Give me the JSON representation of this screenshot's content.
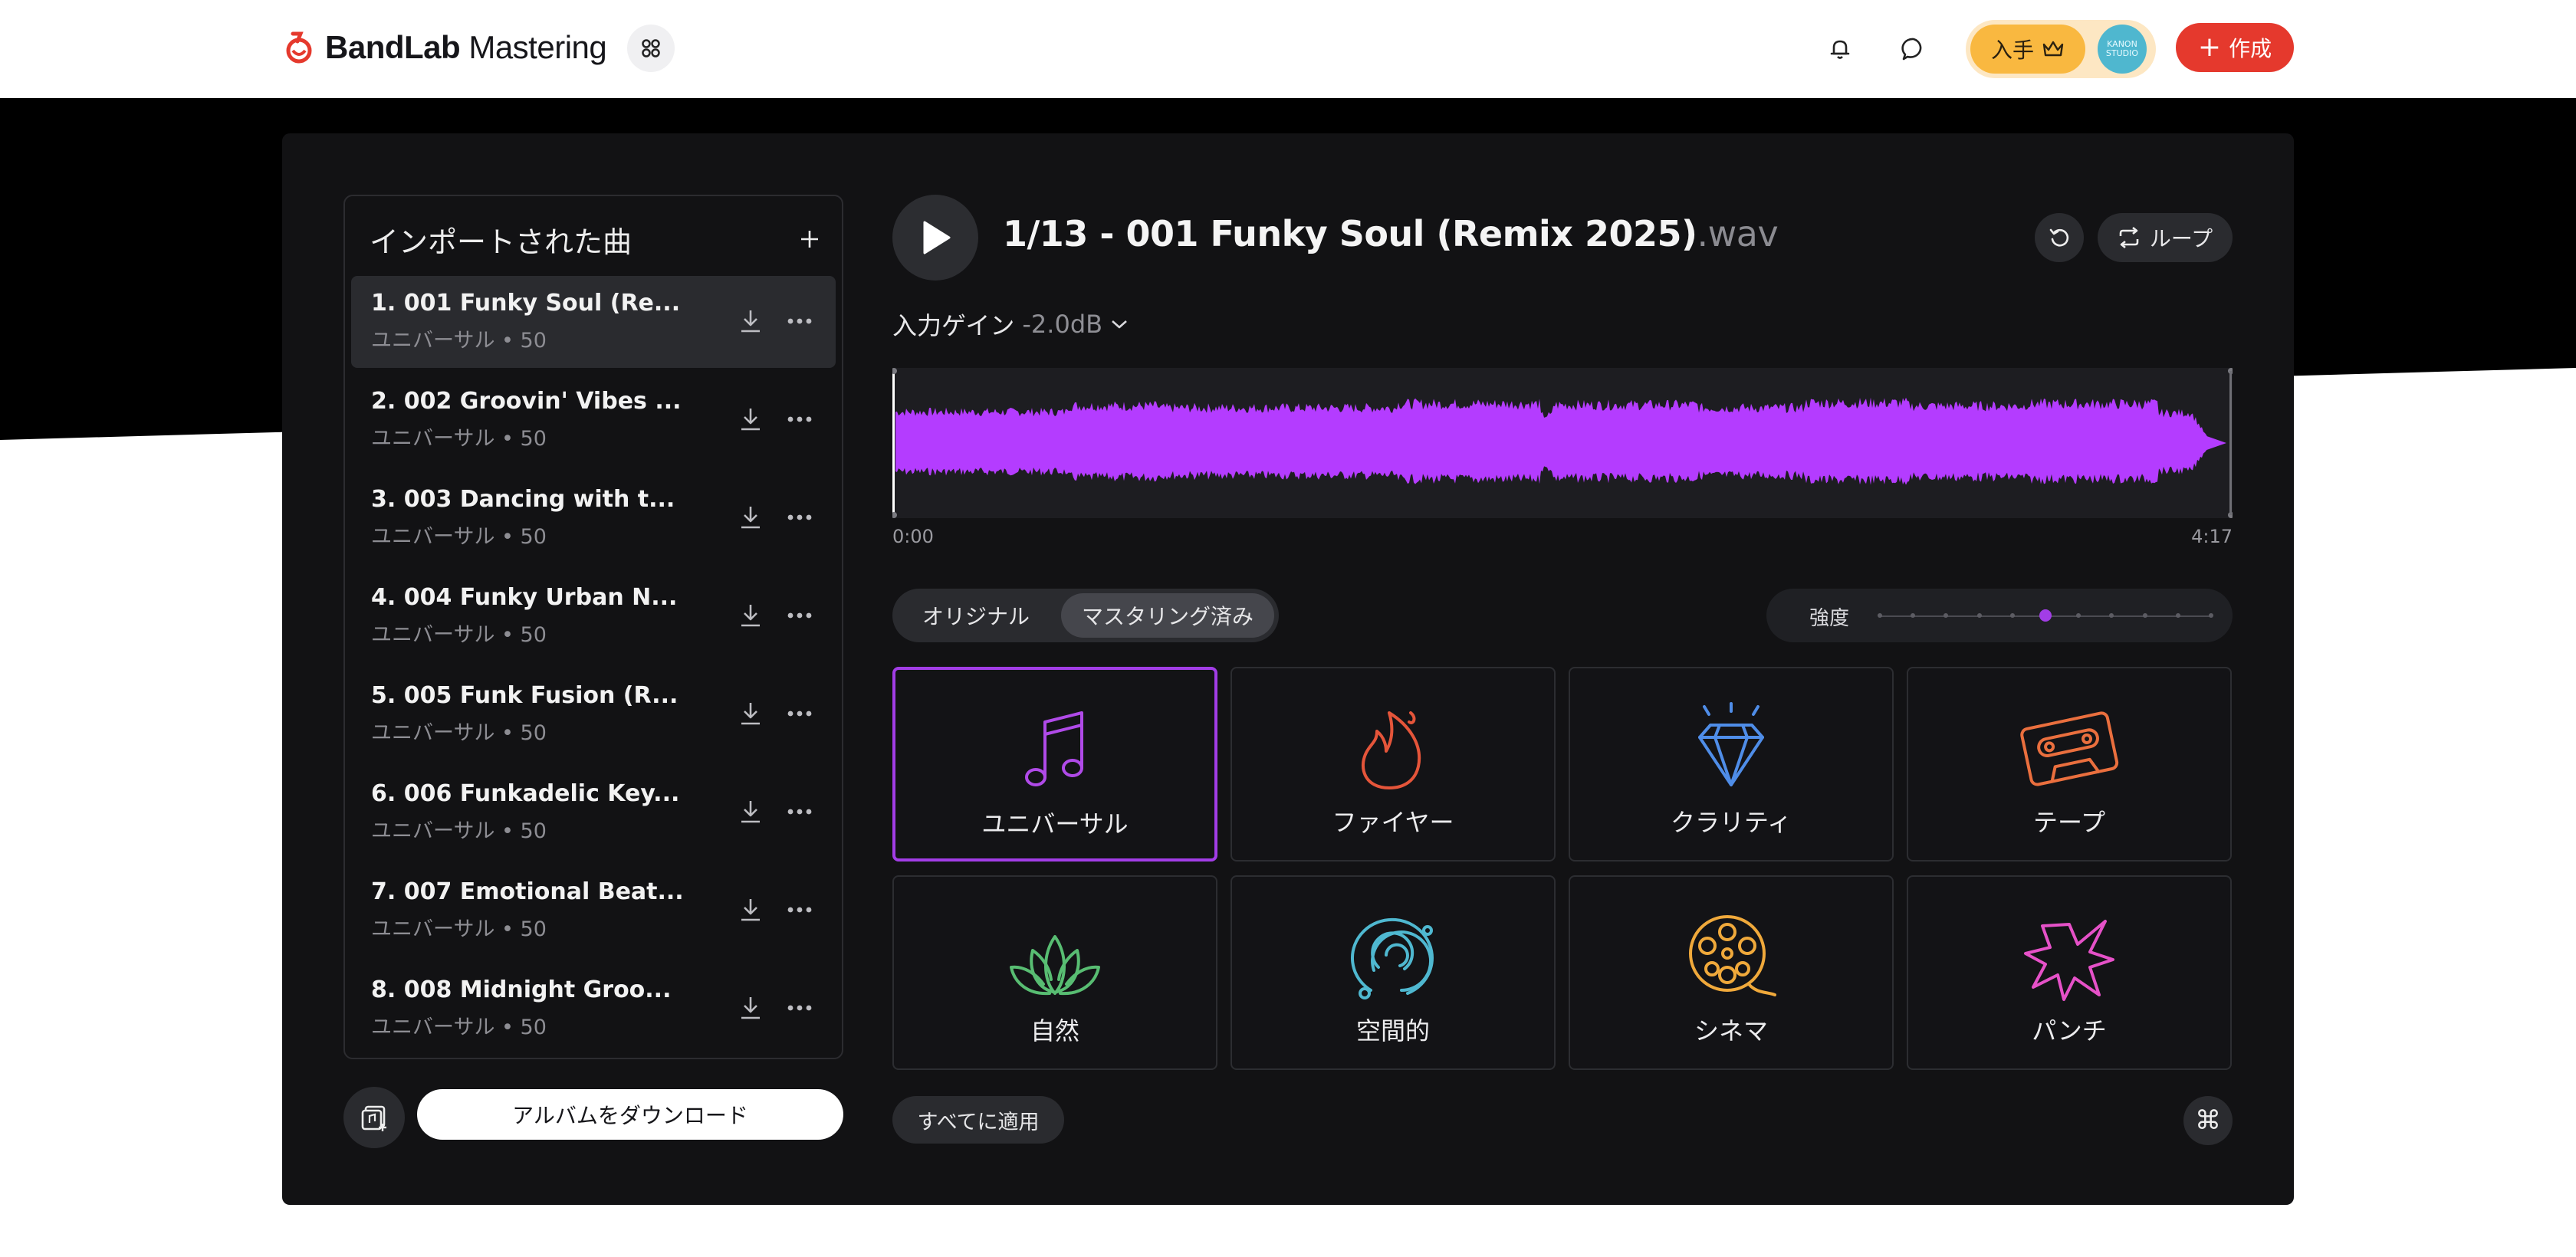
{
  "header": {
    "brand_bold": "BandLab",
    "brand_rest": " Mastering",
    "get_label": "入手",
    "avatar_text": "KANON STUDIO",
    "create_label": "作成"
  },
  "sidebar": {
    "title": "インポートされた曲",
    "tracks": [
      {
        "name": "1. 001 Funky Soul (Re...",
        "sub": "ユニバーサル • 50"
      },
      {
        "name": "2. 002 Groovin' Vibes ...",
        "sub": "ユニバーサル • 50"
      },
      {
        "name": "3. 003 Dancing with t...",
        "sub": "ユニバーサル • 50"
      },
      {
        "name": "4. 004 Funky Urban N...",
        "sub": "ユニバーサル • 50"
      },
      {
        "name": "5. 005 Funk Fusion (R...",
        "sub": "ユニバーサル • 50"
      },
      {
        "name": "6. 006 Funkadelic Key...",
        "sub": "ユニバーサル • 50"
      },
      {
        "name": "7. 007 Emotional Beat...",
        "sub": "ユニバーサル • 50"
      },
      {
        "name": "8. 008 Midnight Groo...",
        "sub": "ユニバーサル • 50"
      }
    ],
    "download_album": "アルバムをダウンロード"
  },
  "player": {
    "title": "1/13 - 001 Funky Soul (Remix 2025)",
    "ext": ".wav",
    "loop_label": "ループ",
    "gain_label": "入力ゲイン",
    "gain_value": "-2.0dB",
    "time_start": "0:00",
    "time_end": "4:17"
  },
  "mode": {
    "original": "オリジナル",
    "mastered": "マスタリング済み",
    "selected": "mastered"
  },
  "intensity": {
    "label": "強度",
    "level": 0.5,
    "steps": 11
  },
  "presets": [
    {
      "label": "ユニバーサル",
      "icon": "music-note-icon",
      "color": "#b04ae8",
      "selected": true
    },
    {
      "label": "ファイヤー",
      "icon": "fire-icon",
      "color": "#e5553a",
      "selected": false
    },
    {
      "label": "クラリティ",
      "icon": "diamond-icon",
      "color": "#4f8de8",
      "selected": false
    },
    {
      "label": "テープ",
      "icon": "cassette-icon",
      "color": "#ea6f3e",
      "selected": false
    },
    {
      "label": "自然",
      "icon": "lotus-icon",
      "color": "#58bd72",
      "selected": false
    },
    {
      "label": "空間的",
      "icon": "spiral-icon",
      "color": "#4fb8d0",
      "selected": false
    },
    {
      "label": "シネマ",
      "icon": "film-reel-icon",
      "color": "#f0a93b",
      "selected": false
    },
    {
      "label": "パンチ",
      "icon": "burst-icon",
      "color": "#e651c8",
      "selected": false
    }
  ],
  "footer": {
    "apply_all": "すべてに適用",
    "cmd_symbol": "⌘"
  },
  "colors": {
    "accent": "#a23de6",
    "waveform": "#b43cff",
    "create": "#e5392d",
    "get": "#f9b840"
  }
}
